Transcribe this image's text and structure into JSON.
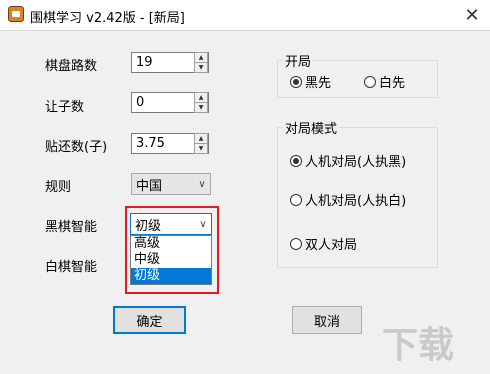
{
  "window": {
    "title": "围棋学习 v2.42版 - [新局]",
    "close_glyph": "✕"
  },
  "settings": {
    "board_size": {
      "label": "棋盘路数",
      "value": "19"
    },
    "handicap": {
      "label": "让子数",
      "value": "0"
    },
    "komi": {
      "label": "贴还数(子)",
      "value": "3.75"
    },
    "rules": {
      "label": "规则",
      "value": "中国"
    },
    "black_ai": {
      "label": "黑棋智能",
      "value": "初级",
      "options": [
        "高级",
        "中级",
        "初级"
      ],
      "selected_index": 2
    },
    "white_ai": {
      "label": "白棋智能"
    }
  },
  "opening": {
    "title": "开局",
    "options": [
      "黑先",
      "白先"
    ],
    "selected": "黑先"
  },
  "mode": {
    "title": "对局模式",
    "options": [
      "人机对局(人执黑)",
      "人机对局(人执白)",
      "双人对局"
    ],
    "selected": "人机对局(人执黑)"
  },
  "buttons": {
    "ok": "确定",
    "cancel": "取消"
  },
  "watermark": "下载",
  "colors": {
    "accent": "#0078d7",
    "highlight_box": "#e31b23"
  }
}
